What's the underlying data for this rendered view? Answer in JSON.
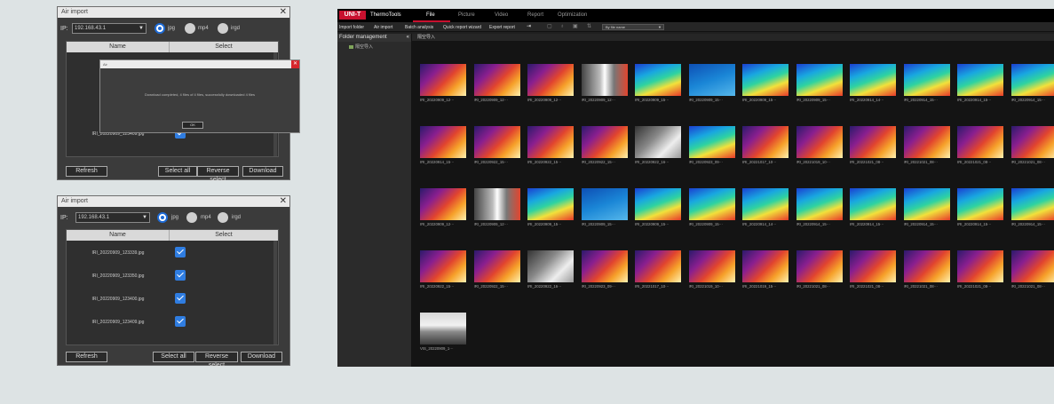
{
  "air_import_1": {
    "title": "Air import",
    "ip_label": "IP:",
    "ip_value": "192.168.43.1",
    "formats": [
      "jpg",
      "mp4",
      "irgd"
    ],
    "col_name": "Name",
    "col_select": "Select",
    "rows": [
      "IRI_202",
      "IRI_202",
      "IRI_202",
      "IRI_20220909_123409.jpg"
    ],
    "buttons": {
      "refresh": "Refresh",
      "select_all": "Select all",
      "reverse": "Reverse select",
      "download": "Download"
    },
    "message": {
      "title": "Air",
      "text": "Download completed, 4 files of 4 files, successfully downloaded 4 files",
      "ok": "OK"
    }
  },
  "air_import_2": {
    "title": "Air import",
    "ip_label": "IP:",
    "ip_value": "192.168.43.1",
    "formats": [
      "jpg",
      "mp4",
      "irgd"
    ],
    "col_name": "Name",
    "col_select": "Select",
    "rows": [
      "IRI_20220909_123339.jpg",
      "IRI_20220909_123350.jpg",
      "IRI_20220909_123400.jpg",
      "IRI_20220909_123409.jpg"
    ],
    "buttons": {
      "refresh": "Refresh",
      "select_all": "Select all",
      "reverse": "Reverse select",
      "download": "Download"
    }
  },
  "thermotools": {
    "logo": "UNI-T",
    "app_name": "ThermoTools",
    "menu_tabs": [
      "File",
      "Picture",
      "Video",
      "Report",
      "Optimization"
    ],
    "active_tab": "File",
    "toolbar": [
      "Import folder",
      "Air import",
      "Batch analysis",
      "Quick report wizard",
      "Export report"
    ],
    "sort_value": "By file name",
    "sidebar_title": "Folder management",
    "sidebar_item": "隔空导入",
    "breadcrumb": "隔空导入",
    "thumbs": [
      "IRI_20220909_12···",
      "IRI_20220909_12···",
      "IRI_20220909_12···",
      "IRI_20220909_12···",
      "IRI_20220909_15···",
      "IRI_20220909_15···",
      "IRI_20220909_15···",
      "IRI_20220909_15···",
      "IRI_20220914_14···",
      "IRI_20220914_15···",
      "IRI_20220914_15···",
      "IRI_20220914_15···",
      "IRI_20220914_15···",
      "IRI_20220922_15···",
      "IRI_20220922_15···",
      "IRI_20220922_15···",
      "IRI_20220922_16···",
      "IRI_20220923_09···",
      "IRI_20221017_10···",
      "IRI_20221019_10···",
      "IRI_20221021_08···",
      "IRI_20221021_08···",
      "IRI_20221021_08···",
      "IRI_20221021_08···",
      "IRI_20220909_12···",
      "IRI_20220909_12···",
      "IRI_20220909_15···",
      "IRI_20220909_15···",
      "IRI_20220909_15···",
      "IRI_20220909_15···",
      "IRI_20220914_14···",
      "IRI_20220914_15···",
      "IRI_20220914_15···",
      "IRI_20220914_15···",
      "IRI_20220914_15···",
      "IRI_20220914_15···",
      "IRI_20220922_15···",
      "IRI_20220922_15···",
      "IRI_20220922_16···",
      "IRI_20220923_09···",
      "IRI_20221017_10···",
      "IRI_20221019_10···",
      "IRI_20221019_15···",
      "IRI_20221021_08···",
      "IRI_20221021_08···",
      "IRI_20221021_08···",
      "IRI_20221021_08···",
      "IRI_20221021_08···",
      "VIS_20220909_1···"
    ],
    "palettes": [
      "iron",
      "iron",
      "iron",
      "mixed",
      "rainbow",
      "blue",
      "rainbow",
      "rainbow",
      "rainbow",
      "rainbow",
      "rainbow",
      "rainbow",
      "iron",
      "iron",
      "iron",
      "iron",
      "gray",
      "rainbow",
      "iron",
      "iron",
      "iron",
      "iron",
      "iron",
      "iron",
      "iron",
      "mixed",
      "rainbow",
      "blue",
      "rainbow",
      "rainbow",
      "rainbow",
      "rainbow",
      "rainbow",
      "rainbow",
      "rainbow",
      "rainbow",
      "iron",
      "iron",
      "gray",
      "iron",
      "iron",
      "iron",
      "iron",
      "iron",
      "iron",
      "iron",
      "iron",
      "iron",
      "visible"
    ]
  }
}
